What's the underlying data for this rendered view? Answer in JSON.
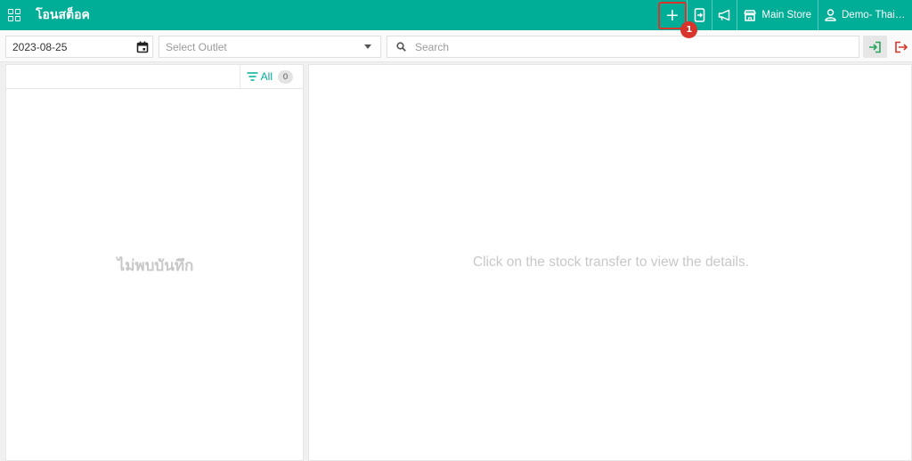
{
  "app": {
    "title": "โอนสต็อค"
  },
  "header": {
    "add_badge": "1",
    "store_label": "Main Store",
    "user_label": "Demo- Thailand"
  },
  "filters": {
    "date_value": "2023-08-25",
    "outlet_placeholder": "Select Outlet",
    "search_placeholder": "Search"
  },
  "list": {
    "filter_label": "All",
    "count": "0",
    "empty_text": "ไม่พบบันทึก"
  },
  "detail": {
    "empty_text": "Click on the stock transfer to view the details."
  },
  "colors": {
    "primary": "#00ad96",
    "highlight": "#d9342b",
    "import": "#26a65b",
    "export": "#d9342b"
  }
}
